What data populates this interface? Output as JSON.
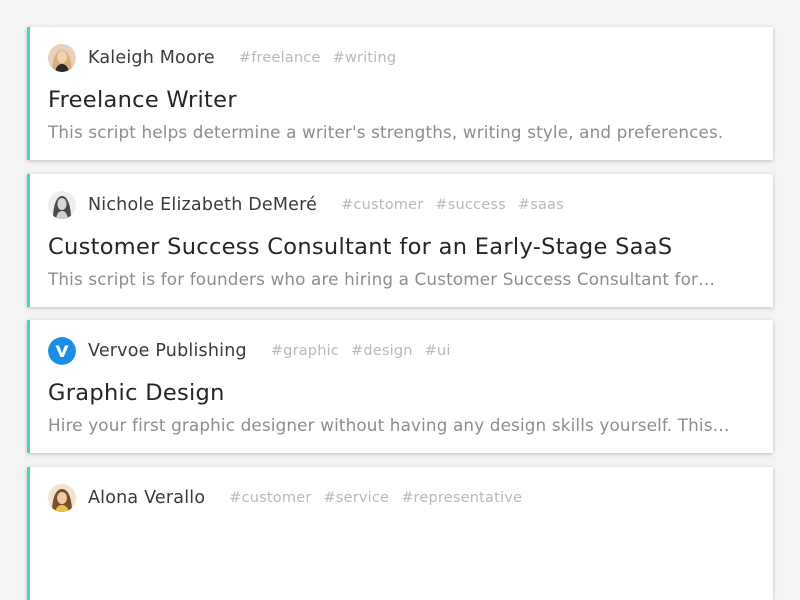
{
  "colors": {
    "accent": "#4ed1b9",
    "background": "#f4f4f4",
    "tag": "#b9b9b9",
    "description": "#8d8d8d",
    "vervoe_blue": "#1a8de6"
  },
  "cards": [
    {
      "author": "Kaleigh Moore",
      "avatar_icon": "person-avatar-blonde",
      "tags": [
        "#freelance",
        "#writing"
      ],
      "title": "Freelance Writer",
      "description": "This script helps determine a writer's strengths, writing style, and preferences."
    },
    {
      "author": "Nichole Elizabeth DeMeré",
      "avatar_icon": "person-avatar-grayscale",
      "tags": [
        "#customer",
        "#success",
        "#saas"
      ],
      "title": "Customer Success Consultant for an Early-Stage SaaS",
      "description": "This script is for founders who are hiring a Customer Success Consultant for…"
    },
    {
      "author": "Vervoe Publishing",
      "avatar_icon": "vervoe-logo",
      "tags": [
        "#graphic",
        "#design",
        "#ui"
      ],
      "title": "Graphic Design",
      "description": "Hire your first graphic designer without having any design skills yourself. This…"
    },
    {
      "author": "Alona Verallo",
      "avatar_icon": "person-avatar-brunette",
      "tags": [
        "#customer",
        "#service",
        "#representative"
      ],
      "title": "",
      "description": ""
    }
  ]
}
